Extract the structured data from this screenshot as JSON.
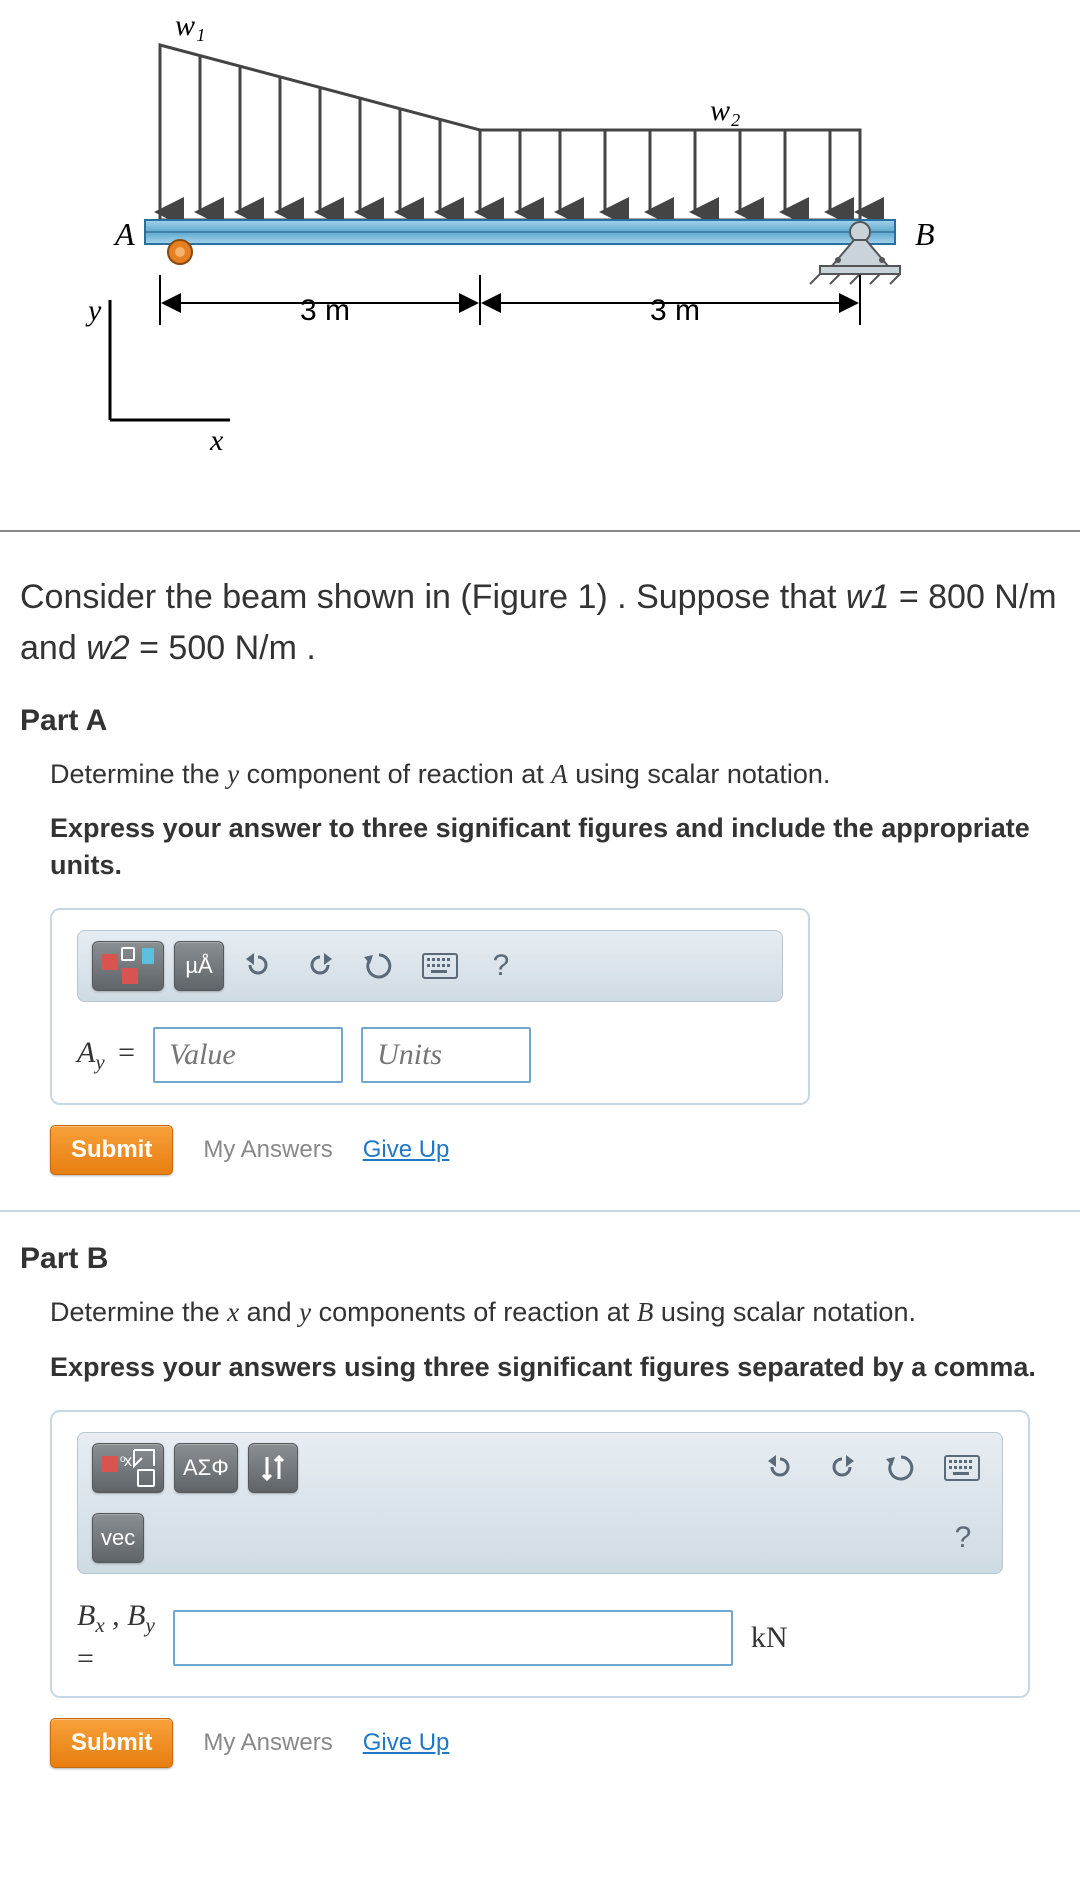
{
  "figure": {
    "labels": {
      "w1": "w₁",
      "w2": "w₂",
      "A": "A",
      "B": "B",
      "y": "y",
      "x": "x"
    },
    "dims": {
      "d1": "3 m",
      "d2": "3 m"
    }
  },
  "statement": {
    "line1_a": "Consider the beam shown in (Figure 1) . Suppose that ",
    "line1_w1": "w1",
    "line1_b": " = 800 N/m and ",
    "line1_w2": "w2",
    "line1_c": " = 500 N/m ."
  },
  "partA": {
    "title": "Part A",
    "prompt_a": "Determine the ",
    "prompt_y": "y",
    "prompt_b": " component of reaction at ",
    "prompt_A": "A",
    "prompt_c": " using scalar notation.",
    "hint": "Express your answer to three significant figures and include the appropriate units.",
    "lhs": "A_y =",
    "value_ph": "Value",
    "units_ph": "Units",
    "toolbar": {
      "units_btn": "µÅ",
      "help": "?"
    },
    "submit": "Submit",
    "myanswers": "My Answers",
    "giveup": "Give Up"
  },
  "partB": {
    "title": "Part B",
    "prompt_a": "Determine the ",
    "prompt_x": "x",
    "prompt_and": " and ",
    "prompt_y": "y",
    "prompt_b": " components of reaction at ",
    "prompt_B": "B",
    "prompt_c": " using scalar notation.",
    "hint": "Express your answers using three significant figures separated by a comma.",
    "lhs1": "B_x , B_y",
    "lhs2": "=",
    "unit": "kN",
    "toolbar": {
      "greek": "ΑΣΦ",
      "vec": "vec",
      "help": "?"
    },
    "submit": "Submit",
    "myanswers": "My Answers",
    "giveup": "Give Up"
  }
}
